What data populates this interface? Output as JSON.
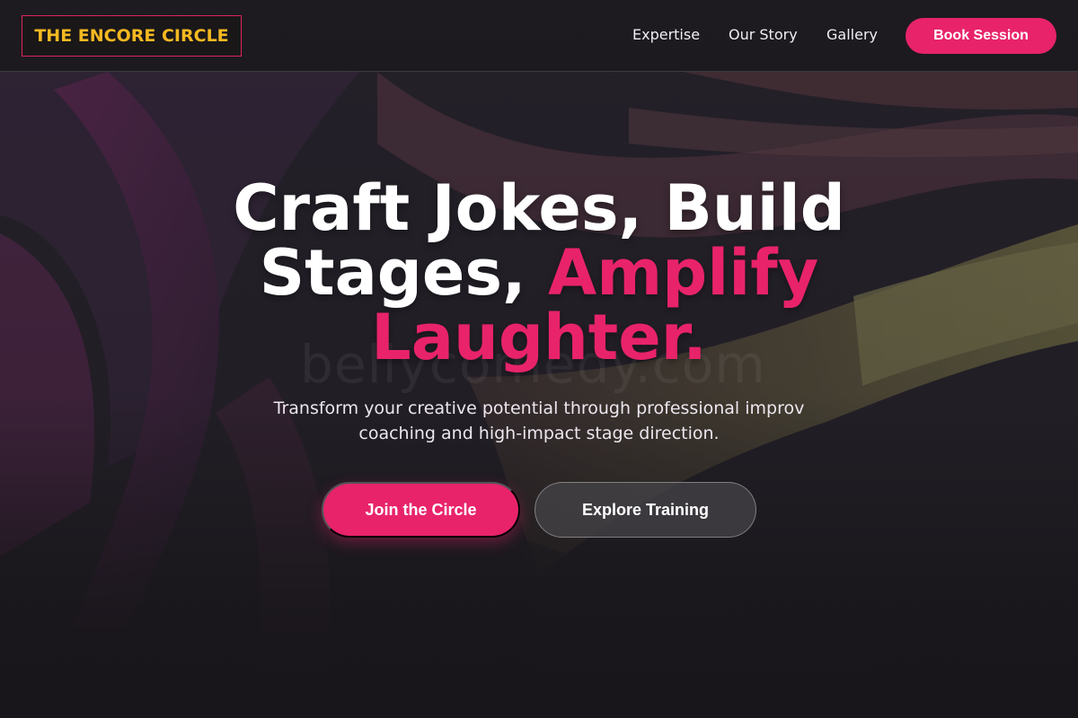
{
  "header": {
    "logo_text": "THE ENCORE CIRCLE",
    "nav": {
      "expertise": "Expertise",
      "our_story": "Our Story",
      "gallery": "Gallery"
    },
    "cta_label": "Book Session"
  },
  "hero": {
    "title_line1": "Craft Jokes, Build",
    "title_line2_plain": "Stages, ",
    "title_line2_accent": "Amplify",
    "title_line3_accent": "Laughter.",
    "subtitle_line1": "Transform your creative potential through professional improv",
    "subtitle_line2": "coaching and high-impact stage direction.",
    "primary_button": "Join the Circle",
    "secondary_button": "Explore Training",
    "watermark": "bellycomedy.com"
  },
  "colors": {
    "accent": "#e8236a",
    "logo_gold": "#f5b921",
    "background": "#1d1b20"
  }
}
